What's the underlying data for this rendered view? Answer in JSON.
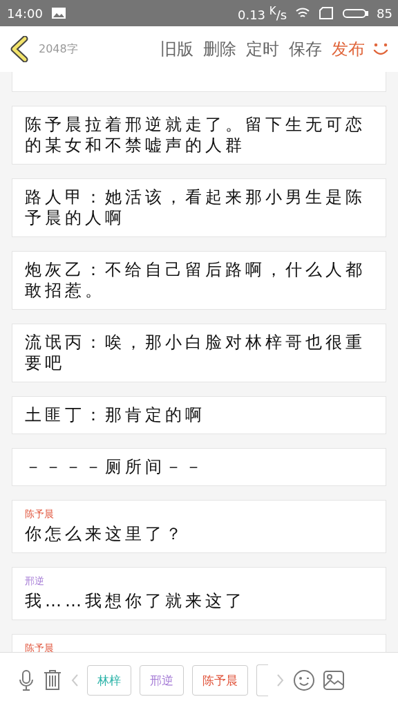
{
  "status_bar": {
    "time": "14:00",
    "speed": "0.13 $^{K}$/s",
    "battery": "85"
  },
  "header": {
    "word_count": "2048字",
    "actions": [
      {
        "label": "旧版",
        "highlighted": false
      },
      {
        "label": "删除",
        "highlighted": false
      },
      {
        "label": "定时",
        "highlighted": false
      },
      {
        "label": "保存",
        "highlighted": false
      },
      {
        "label": "发布",
        "highlighted": true
      }
    ]
  },
  "entries": [
    {
      "kind": "narration",
      "text": "陈予晨拉着邢逆就走了。留下生无可恋的某女和不禁嘘声的人群"
    },
    {
      "kind": "narration",
      "text": "路人甲：她活该，看起来那小男生是陈予晨的人啊"
    },
    {
      "kind": "narration",
      "text": "炮灰乙：不给自己留后路啊，什么人都敢招惹。"
    },
    {
      "kind": "narration",
      "text": "流氓丙：唉，那小白脸对林梓哥也很重要吧"
    },
    {
      "kind": "narration",
      "text": "土匪丁：那肯定的啊"
    },
    {
      "kind": "narration",
      "text": "－－－－厕所间－－"
    },
    {
      "kind": "dialogue",
      "speaker": "陈予晨",
      "color": "#e0533a",
      "text": "你怎么来这里了？"
    },
    {
      "kind": "dialogue",
      "speaker": "邢逆",
      "color": "#a57bd6",
      "text": "我……我想你了就来这了"
    },
    {
      "kind": "dialogue",
      "speaker": "陈予晨",
      "color": "#e0533a"
    }
  ],
  "characters": [
    {
      "name": "林梓",
      "color": "#2bb3a8"
    },
    {
      "name": "邢逆",
      "color": "#a57bd6"
    },
    {
      "name": "陈予晨",
      "color": "#e0533a"
    }
  ]
}
